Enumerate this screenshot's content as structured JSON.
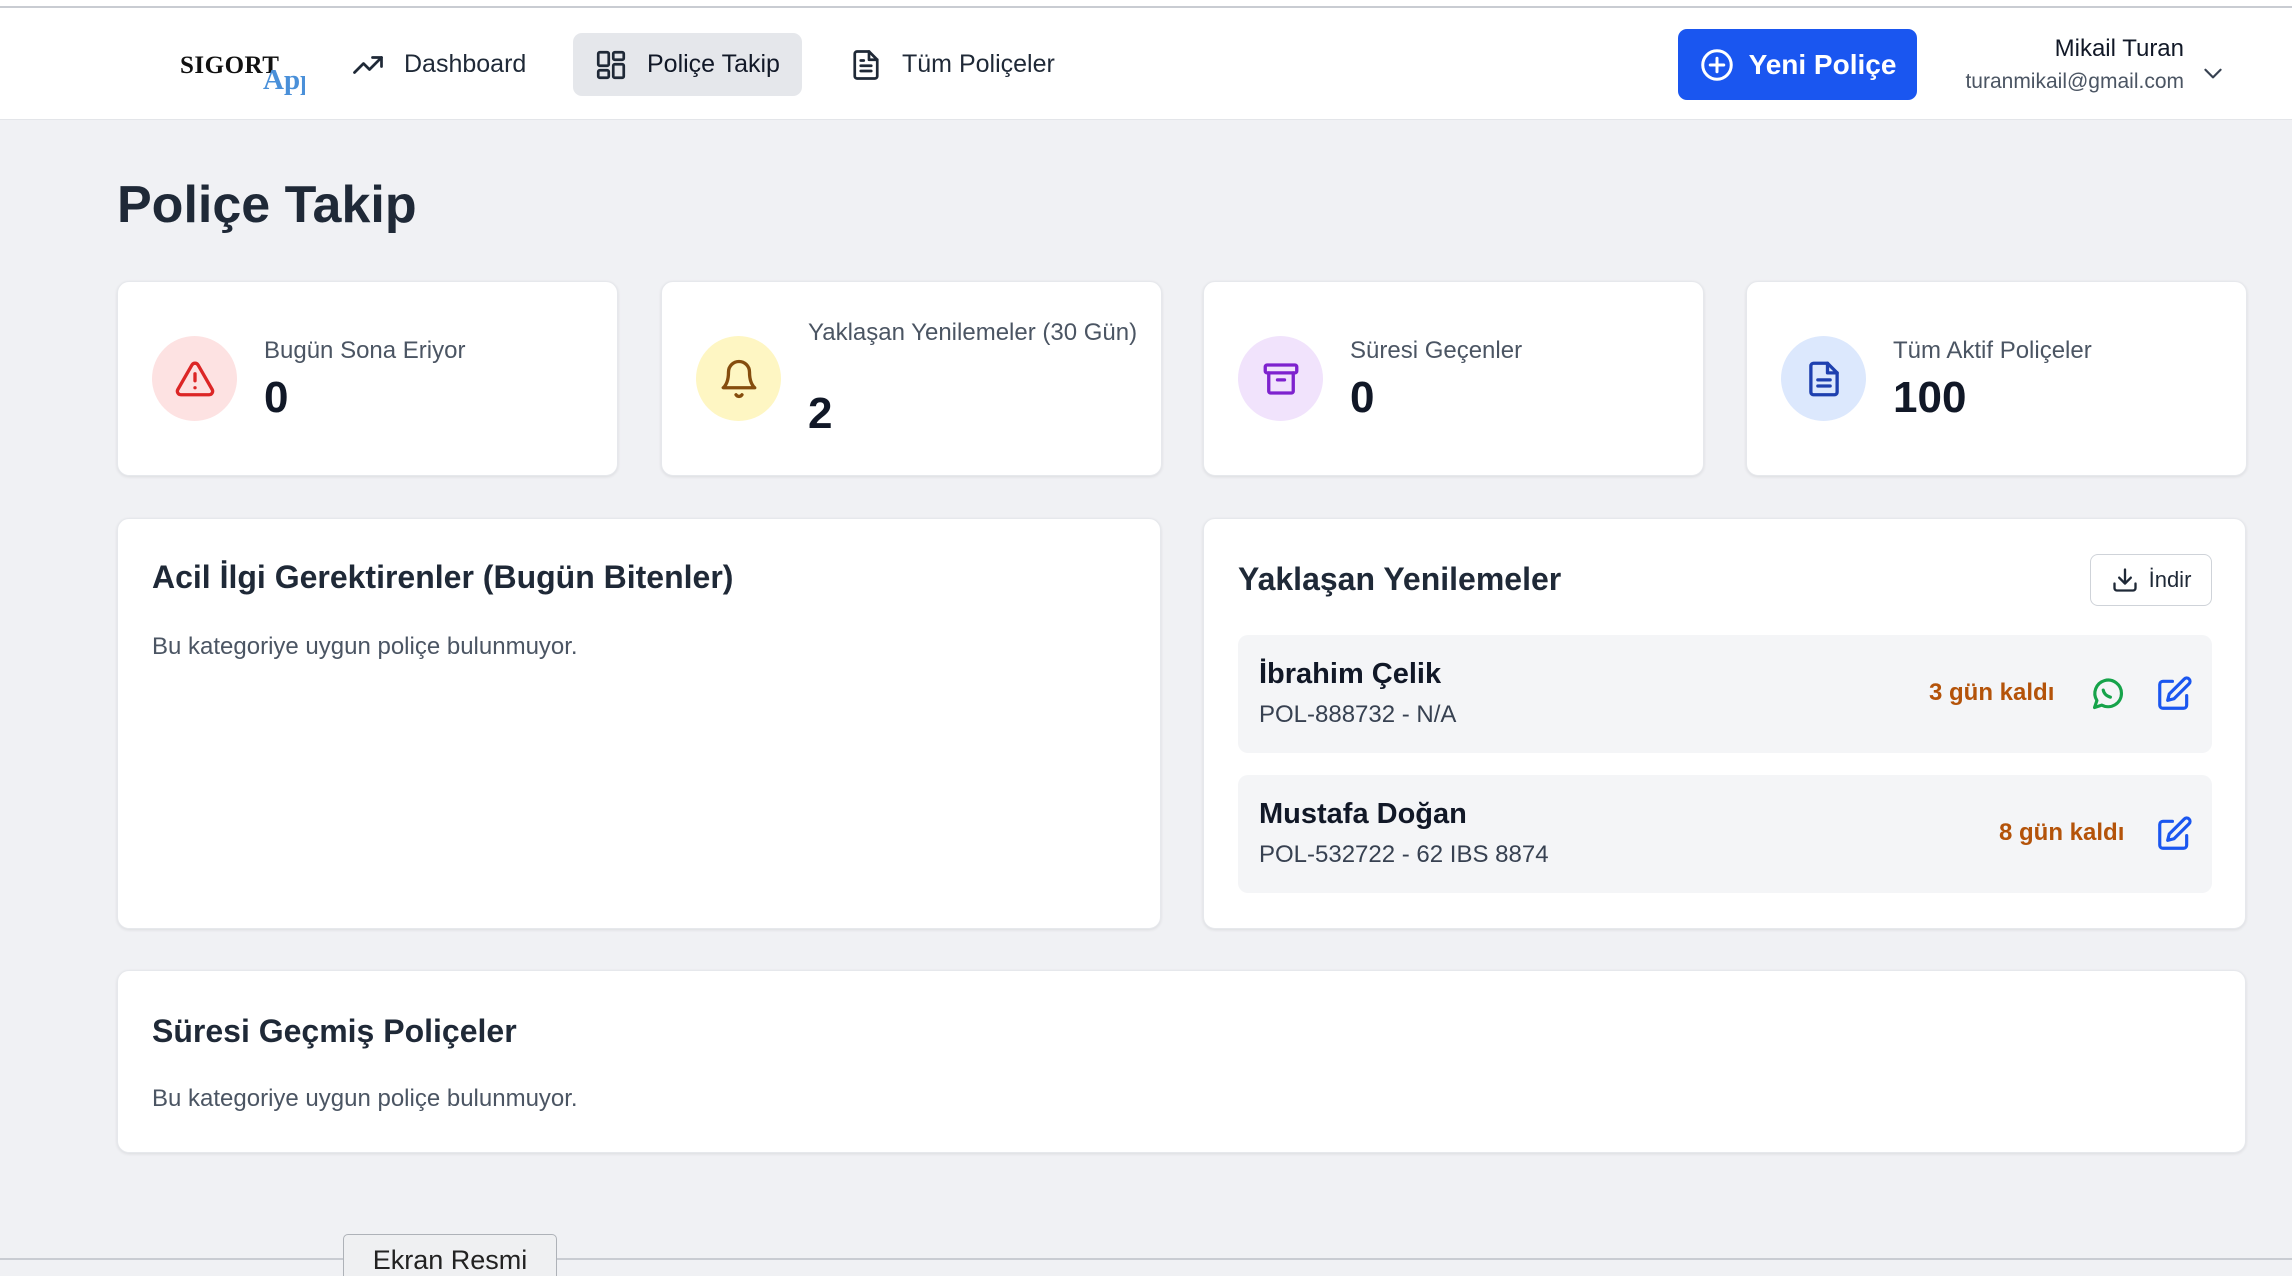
{
  "logo": {
    "part1": "SIGORT",
    "part2": "App"
  },
  "nav": {
    "dashboard": "Dashboard",
    "police_takip": "Poliçe Takip",
    "tum_policeler": "Tüm Poliçeler"
  },
  "new_policy_button": "Yeni Poliçe",
  "user": {
    "name": "Mikail Turan",
    "email": "turanmikail@gmail.com"
  },
  "page_title": "Poliçe Takip",
  "stats": [
    {
      "label": "Bugün Sona Eriyor",
      "value": "0",
      "icon": "alert-triangle-icon",
      "color": "#dc2626",
      "bg": "#fde2e2"
    },
    {
      "label": "Yaklaşan Yenilemeler (30 Gün)",
      "value": "2",
      "icon": "bell-icon",
      "color": "#854d0e",
      "bg": "#fef6c3"
    },
    {
      "label": "Süresi Geçenler",
      "value": "0",
      "icon": "archive-icon",
      "color": "#7e22ce",
      "bg": "#f1e3fc"
    },
    {
      "label": "Tüm Aktif Poliçeler",
      "value": "100",
      "icon": "document-icon",
      "color": "#1e40af",
      "bg": "#dce8fd"
    }
  ],
  "urgent": {
    "title": "Acil İlgi Gerektirenler (Bugün Bitenler)",
    "empty_text": "Bu kategoriye uygun poliçe bulunmuyor."
  },
  "upcoming": {
    "title": "Yaklaşan Yenilemeler",
    "download_label": "İndir",
    "items": [
      {
        "name": "İbrahim Çelik",
        "policy": "POL-888732 - N/A",
        "days": "3 gün kaldı",
        "has_whatsapp": true
      },
      {
        "name": "Mustafa Doğan",
        "policy": "POL-532722 - 62 IBS 8874",
        "days": "8 gün kaldı",
        "has_whatsapp": false
      }
    ]
  },
  "expired": {
    "title": "Süresi Geçmiş Poliçeler",
    "empty_text": "Bu kategoriye uygun poliçe bulunmuyor."
  },
  "tooltip": "Ekran Resmi",
  "colors": {
    "accent": "#1a56f0",
    "days_warning": "#b45309",
    "whatsapp": "#16a34a",
    "edit": "#1a56f0"
  }
}
